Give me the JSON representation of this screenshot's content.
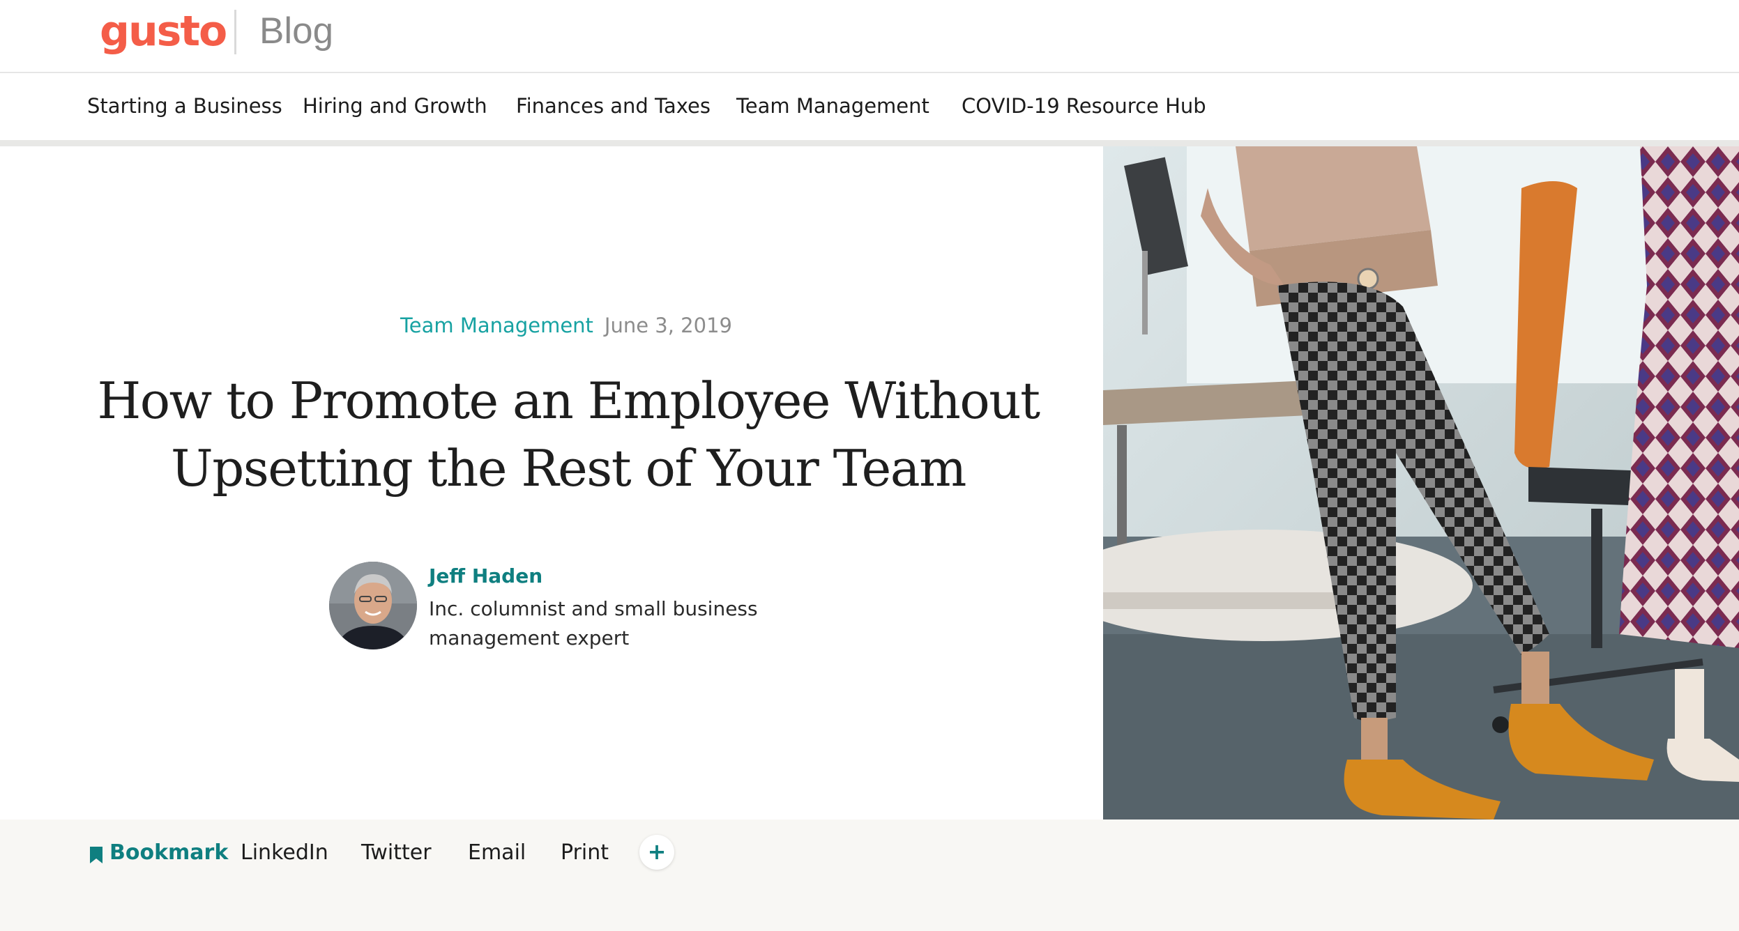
{
  "header": {
    "logo_text": "gusto",
    "section_label": "Blog"
  },
  "nav": {
    "items": [
      {
        "label": "Starting a Business"
      },
      {
        "label": "Hiring and Growth"
      },
      {
        "label": "Finances and Taxes"
      },
      {
        "label": "Team Management"
      },
      {
        "label": "COVID-19 Resource Hub"
      }
    ]
  },
  "article": {
    "category": "Team Management",
    "date": "June 3, 2019",
    "title": "How to Promote an Employee Without Upsetting the Rest of Your Team",
    "author": {
      "name": "Jeff Haden",
      "bio": "Inc. columnist and small business management expert"
    }
  },
  "share": {
    "bookmark": "Bookmark",
    "linkedin": "LinkedIn",
    "twitter": "Twitter",
    "email": "Email",
    "print": "Print",
    "more": "+"
  },
  "colors": {
    "brand": "#f45d48",
    "accent": "#17a2a2",
    "link": "#0f7f80"
  },
  "icons": [
    "bookmark-icon",
    "plus-icon"
  ]
}
